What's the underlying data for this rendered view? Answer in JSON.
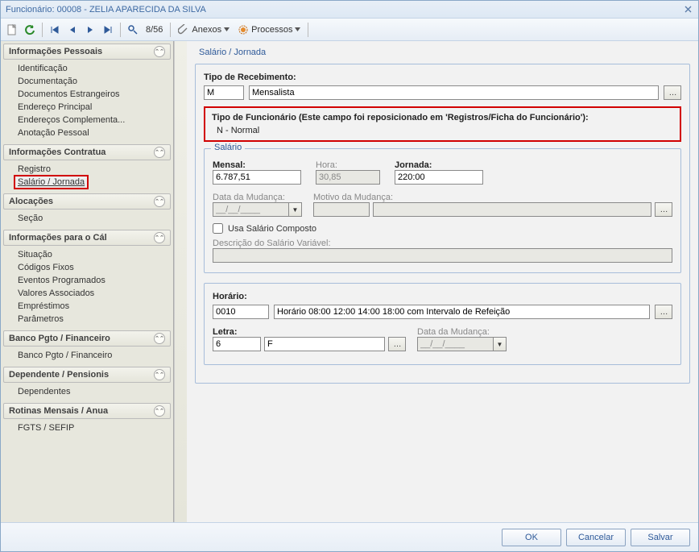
{
  "title": "Funcionário: 00008 - ZELIA APARECIDA DA SILVA",
  "toolbar": {
    "counter": "8/56",
    "anexos": "Anexos",
    "processos": "Processos"
  },
  "sidebar": {
    "groups": [
      {
        "title": "Informações Pessoais",
        "items": [
          "Identificação",
          "Documentação",
          "Documentos Estrangeiros",
          "Endereço Principal",
          "Endereços Complementa...",
          "Anotação Pessoal"
        ]
      },
      {
        "title": "Informações Contratua",
        "items": [
          "Registro",
          "Salário / Jornada"
        ],
        "selected": 1
      },
      {
        "title": "Alocações",
        "items": [
          "Seção"
        ]
      },
      {
        "title": "Informações para o Cál",
        "items": [
          "Situação",
          "Códigos Fixos",
          "Eventos Programados",
          "Valores Associados",
          "Empréstimos",
          "Parâmetros"
        ]
      },
      {
        "title": "Banco Pgto / Financeiro",
        "items": [
          "Banco Pgto / Financeiro"
        ]
      },
      {
        "title": "Dependente / Pensionis",
        "items": [
          "Dependentes"
        ]
      },
      {
        "title": "Rotinas Mensais / Anua",
        "items": [
          "FGTS / SEFIP"
        ]
      }
    ]
  },
  "form": {
    "tab": "Salário / Jornada",
    "tipo_receb_label": "Tipo de Recebimento:",
    "tipo_receb_code": "M",
    "tipo_receb_desc": "Mensalista",
    "tipo_func_label": "Tipo de Funcionário (Este campo foi reposicionado em 'Registros/Ficha do Funcionário'):",
    "tipo_func_val": "N - Normal",
    "salario_legend": "Salário",
    "mensal_label": "Mensal:",
    "mensal_val": "6.787,51",
    "hora_label": "Hora:",
    "hora_val": "30,85",
    "jornada_label": "Jornada:",
    "jornada_val": "220:00",
    "data_mud_label": "Data da Mudança:",
    "data_mud_val": "__/__/____",
    "motivo_label": "Motivo da Mudança:",
    "usa_salario_composto": "Usa Salário Composto",
    "desc_sal_var_label": "Descrição do Salário Variável:",
    "horario_label": "Horário:",
    "horario_code": "0010",
    "horario_desc": "Horário 08:00 12:00 14:00 18:00 com Intervalo de Refeição",
    "letra_label": "Letra:",
    "letra_code": "6",
    "letra_desc": "F",
    "data_mud2_label": "Data da Mudança:",
    "data_mud2_val": "__/__/____"
  },
  "footer": {
    "ok": "OK",
    "cancelar": "Cancelar",
    "salvar": "Salvar"
  }
}
